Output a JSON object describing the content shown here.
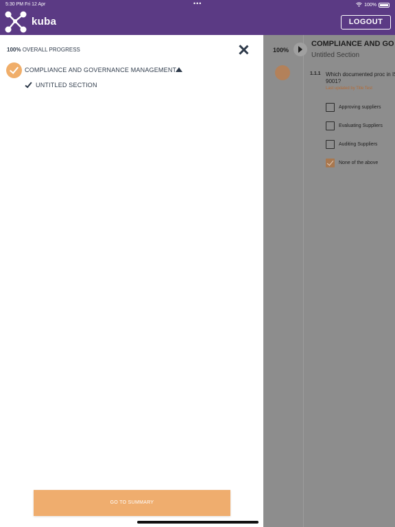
{
  "status_bar": {
    "left": "5:30 PM   Fri 12 Apr",
    "battery": "100%"
  },
  "header": {
    "brand": "kuba",
    "logout_label": "LOGOUT",
    "accent": "#5b3a84"
  },
  "drawer": {
    "progress_value": "100%",
    "progress_label": "OVERALL PROGRESS",
    "section_title": "COMPLIANCE AND GOVERNANCE MANAGEMENT",
    "subsection_title": "UNTITLED SECTION",
    "summary_button": "GO TO SUMMARY",
    "accent": "#f0ae6a"
  },
  "background_view": {
    "progress_value": "100%",
    "title": "COMPLIANCE AND GO",
    "subtitle": "Untitled Section",
    "question_number": "1.1.1",
    "question_text": "Which documented proc in ISO 9001?",
    "last_updated": "Last updated by Title Test",
    "options": [
      {
        "label": "Approving suppliers",
        "checked": false
      },
      {
        "label": "Evaluating Suppliers",
        "checked": false
      },
      {
        "label": "Auditing Suppliers",
        "checked": false
      },
      {
        "label": "None of the above",
        "checked": true
      }
    ]
  }
}
